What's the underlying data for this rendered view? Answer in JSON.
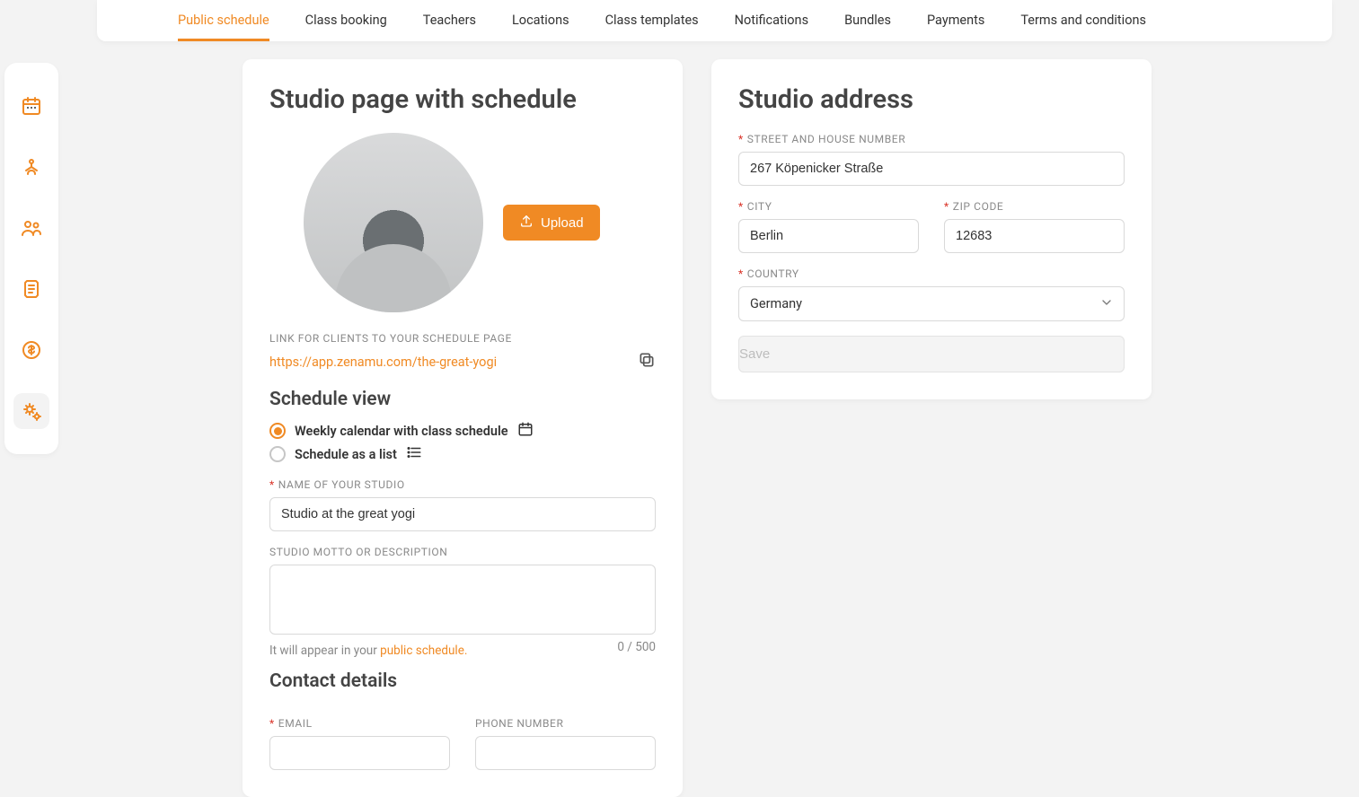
{
  "sidebar": {
    "items": [
      {
        "name": "nav-calendar"
      },
      {
        "name": "nav-classes"
      },
      {
        "name": "nav-people"
      },
      {
        "name": "nav-notes"
      },
      {
        "name": "nav-billing"
      },
      {
        "name": "nav-settings"
      }
    ],
    "active_index": 5
  },
  "tabs": [
    "Public schedule",
    "Class booking",
    "Teachers",
    "Locations",
    "Class templates",
    "Notifications",
    "Bundles",
    "Payments",
    "Terms and conditions"
  ],
  "active_tab_index": 0,
  "studio_page": {
    "title": "Studio page with schedule",
    "upload_label": "Upload",
    "link_label": "LINK FOR CLIENTS TO YOUR SCHEDULE PAGE",
    "link_url": "https://app.zenamu.com/the-great-yogi",
    "schedule_view_title": "Schedule view",
    "view_options": {
      "weekly": "Weekly calendar with class schedule",
      "list": "Schedule as a list"
    },
    "selected_view": "weekly",
    "name_label": "NAME OF YOUR STUDIO",
    "name_value": "Studio at the great yogi",
    "motto_label": "STUDIO MOTTO OR DESCRIPTION",
    "motto_value": "",
    "motto_counter": "0 / 500",
    "motto_help_prefix": "It will appear in your ",
    "motto_help_link": "public schedule.",
    "contact_title": "Contact details",
    "email_label": "EMAIL",
    "phone_label": "PHONE NUMBER"
  },
  "address": {
    "title": "Studio address",
    "street_label": "STREET AND HOUSE NUMBER",
    "street_value": "267 Köpenicker Straße",
    "city_label": "CITY",
    "city_value": "Berlin",
    "zip_label": "ZIP CODE",
    "zip_value": "12683",
    "country_label": "COUNTRY",
    "country_value": "Germany",
    "save_label": "Save"
  }
}
